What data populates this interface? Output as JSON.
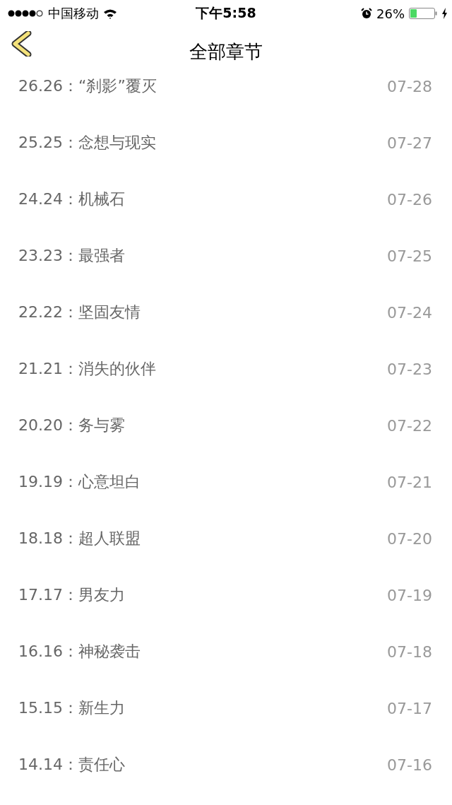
{
  "status_bar": {
    "carrier": "中国移动",
    "time": "下午5:58",
    "battery": "26%"
  },
  "header": {
    "title": "全部章节"
  },
  "chapters": [
    {
      "number": "26.26：",
      "title": "“刹影”覆灭",
      "date": "07-28"
    },
    {
      "number": "25.25：",
      "title": "念想与现实",
      "date": "07-27"
    },
    {
      "number": "24.24：",
      "title": "机械石",
      "date": "07-26"
    },
    {
      "number": "23.23：",
      "title": "最强者",
      "date": "07-25"
    },
    {
      "number": "22.22：",
      "title": "坚固友情",
      "date": "07-24"
    },
    {
      "number": "21.21：",
      "title": "消失的伙伴",
      "date": "07-23"
    },
    {
      "number": "20.20：",
      "title": "务与雾",
      "date": "07-22"
    },
    {
      "number": "19.19：",
      "title": "心意坦白",
      "date": "07-21"
    },
    {
      "number": "18.18：",
      "title": "超人联盟",
      "date": "07-20"
    },
    {
      "number": "17.17：",
      "title": "男友力",
      "date": "07-19"
    },
    {
      "number": "16.16：",
      "title": "神秘袭击",
      "date": "07-18"
    },
    {
      "number": "15.15：",
      "title": "新生力",
      "date": "07-17"
    },
    {
      "number": "14.14：",
      "title": "责任心",
      "date": "07-16"
    }
  ]
}
